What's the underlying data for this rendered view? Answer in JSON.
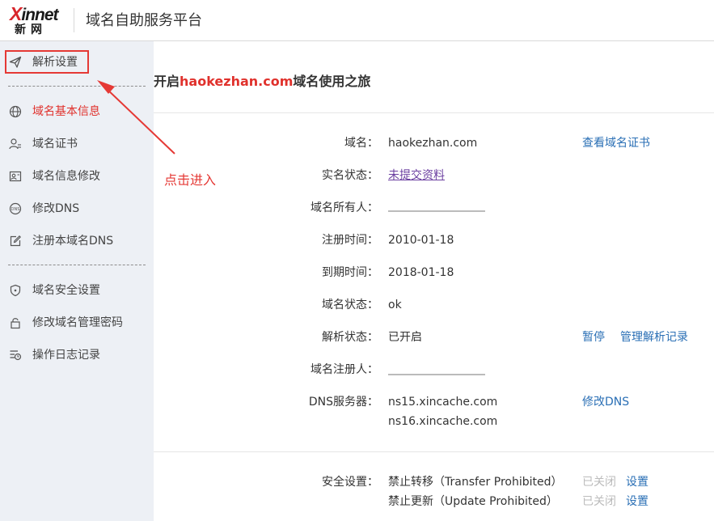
{
  "header": {
    "logo_mark": "xinnet",
    "logo_sub": "新网",
    "title": "域名自助服务平台"
  },
  "sidebar": {
    "items": [
      {
        "label": "解析设置",
        "icon": "paper-plane-icon"
      },
      {
        "label": "域名基本信息",
        "icon": "globe-icon"
      },
      {
        "label": "域名证书",
        "icon": "user-cert-icon"
      },
      {
        "label": "域名信息修改",
        "icon": "id-card-icon"
      },
      {
        "label": "修改DNS",
        "icon": "dns-icon"
      },
      {
        "label": "注册本域名DNS",
        "icon": "edit-icon"
      },
      {
        "label": "域名安全设置",
        "icon": "shield-icon"
      },
      {
        "label": "修改域名管理密码",
        "icon": "lock-icon"
      },
      {
        "label": "操作日志记录",
        "icon": "log-icon"
      }
    ]
  },
  "annotation": {
    "text": "点击进入",
    "color": "#e53935"
  },
  "main": {
    "title_prefix": "开启",
    "title_domain": "haokezhan.com",
    "title_suffix": "域名使用之旅",
    "rows": [
      {
        "label": "域名：",
        "value": "haokezhan.com"
      },
      {
        "label": "实名状态：",
        "value": "未提交资料"
      },
      {
        "label": "域名所有人：",
        "value": ""
      },
      {
        "label": "注册时间：",
        "value": "2010-01-18"
      },
      {
        "label": "到期时间：",
        "value": "2018-01-18"
      },
      {
        "label": "域名状态：",
        "value": "ok"
      },
      {
        "label": "解析状态：",
        "value": "已开启"
      },
      {
        "label": "域名注册人：",
        "value": ""
      },
      {
        "label": "DNS服务器：",
        "value": "ns15.xincache.com",
        "value2": "ns16.xincache.com"
      }
    ],
    "links": {
      "view_cert": "查看域名证书",
      "pause": "暂停",
      "manage_records": "管理解析记录",
      "modify_dns": "修改DNS"
    },
    "security": {
      "label": "安全设置：",
      "items": [
        {
          "text": "禁止转移（Transfer Prohibited）",
          "status": "已关闭",
          "action": "设置"
        },
        {
          "text": "禁止更新（Update Prohibited）",
          "status": "已关闭",
          "action": "设置"
        }
      ]
    }
  },
  "colors": {
    "accent_red": "#e0312c",
    "link_blue": "#2a6fb5",
    "sidebar_bg": "#edf0f5"
  }
}
